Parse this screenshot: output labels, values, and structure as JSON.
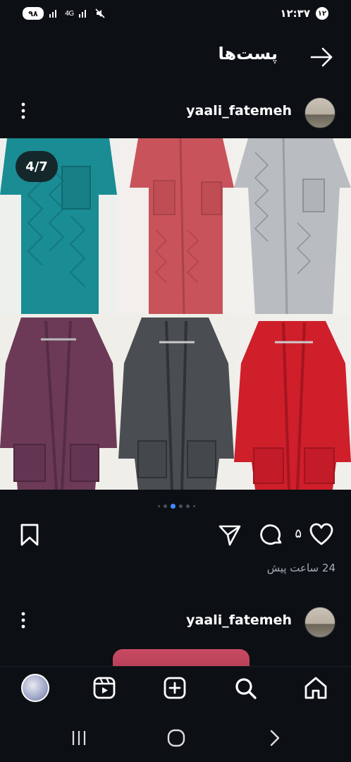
{
  "status_bar": {
    "battery": "۹۸",
    "signal_text": "4G",
    "clock": "۱۲:۳۷",
    "notification_count": "۱۲"
  },
  "header": {
    "title": "پست‌ها"
  },
  "post": {
    "username": "yaali_fatemeh",
    "image_counter": "4/7",
    "like_count": "۵",
    "timestamp": "24 ساعت پیش",
    "carousel": {
      "total_dots": 6,
      "active_index": 2
    }
  },
  "next_post": {
    "username": "yaali_fatemeh"
  },
  "colors": {
    "background": "#0c0f14",
    "accent_dot": "#3f8cff",
    "robe_teal": "#1a8c93",
    "robe_coral": "#c9535a",
    "robe_grey": "#b9bcc0",
    "robe_plum": "#6c3a57",
    "robe_charcoal": "#4a4d52",
    "robe_red": "#cf1f2b"
  },
  "icons": {
    "back": "arrow-right-icon",
    "more": "more-vertical-icon",
    "like": "heart-icon",
    "comment": "comment-icon",
    "share": "send-icon",
    "save": "bookmark-icon",
    "home": "home-icon",
    "search": "search-icon",
    "create": "plus-square-icon",
    "reels": "reels-icon"
  }
}
